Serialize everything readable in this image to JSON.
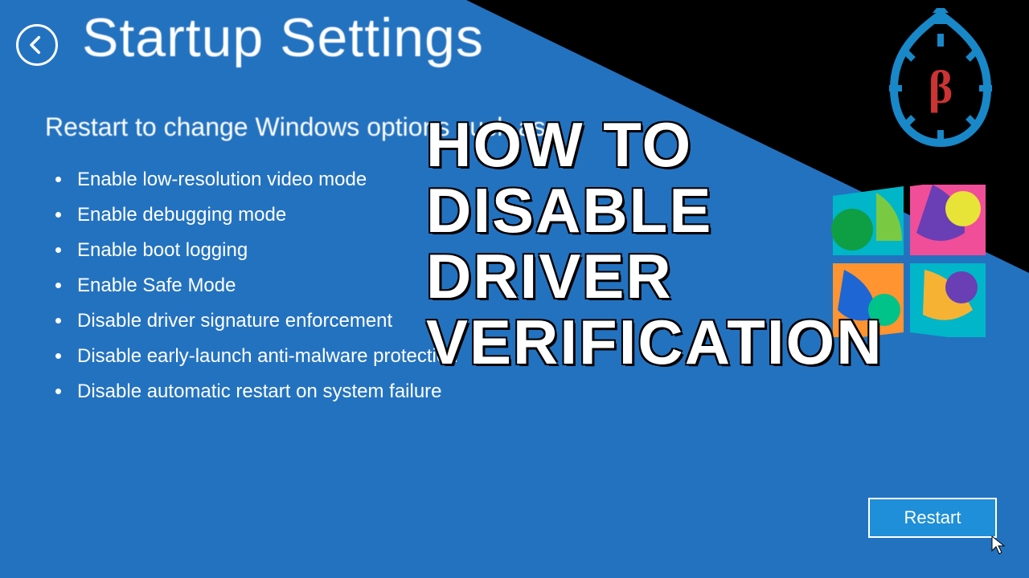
{
  "header": {
    "title": "Startup Settings"
  },
  "subtitle": "Restart to change Windows options such as:",
  "options": [
    "Enable low-resolution video mode",
    "Enable debugging mode",
    "Enable boot logging",
    "Enable Safe Mode",
    "Disable driver signature enforcement",
    "Disable early-launch anti-malware protection",
    "Disable automatic restart on system failure"
  ],
  "buttons": {
    "restart": "Restart"
  },
  "overlay": {
    "line1": "HOW TO",
    "line2": "DISABLE",
    "line3": "DRIVER",
    "line4": "VERIFICATION"
  },
  "logo": {
    "beta_letter": "β"
  }
}
